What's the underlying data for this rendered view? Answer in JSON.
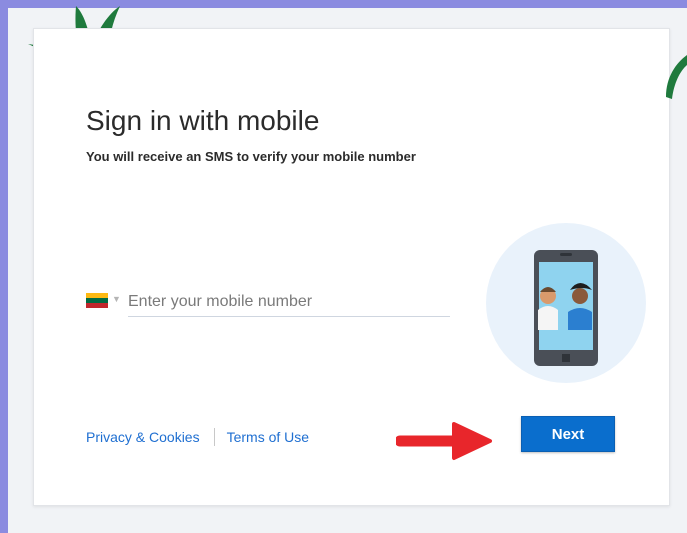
{
  "title": "Sign in with mobile",
  "subtitle": "You will receive an SMS to verify your mobile number",
  "country_flag": {
    "icon": "lithuania-flag-icon",
    "colors": [
      "#fdb913",
      "#006a44",
      "#c1272d"
    ]
  },
  "phone": {
    "placeholder": "Enter your mobile number",
    "value": ""
  },
  "links": {
    "privacy": "Privacy & Cookies",
    "terms": "Terms of Use"
  },
  "next_label": "Next",
  "colors": {
    "accent": "#0a6ecd",
    "link": "#1f6fd1",
    "frame": "#8b8be0",
    "annotation_arrow": "#e8262b",
    "brush": "#1f7a3d"
  }
}
